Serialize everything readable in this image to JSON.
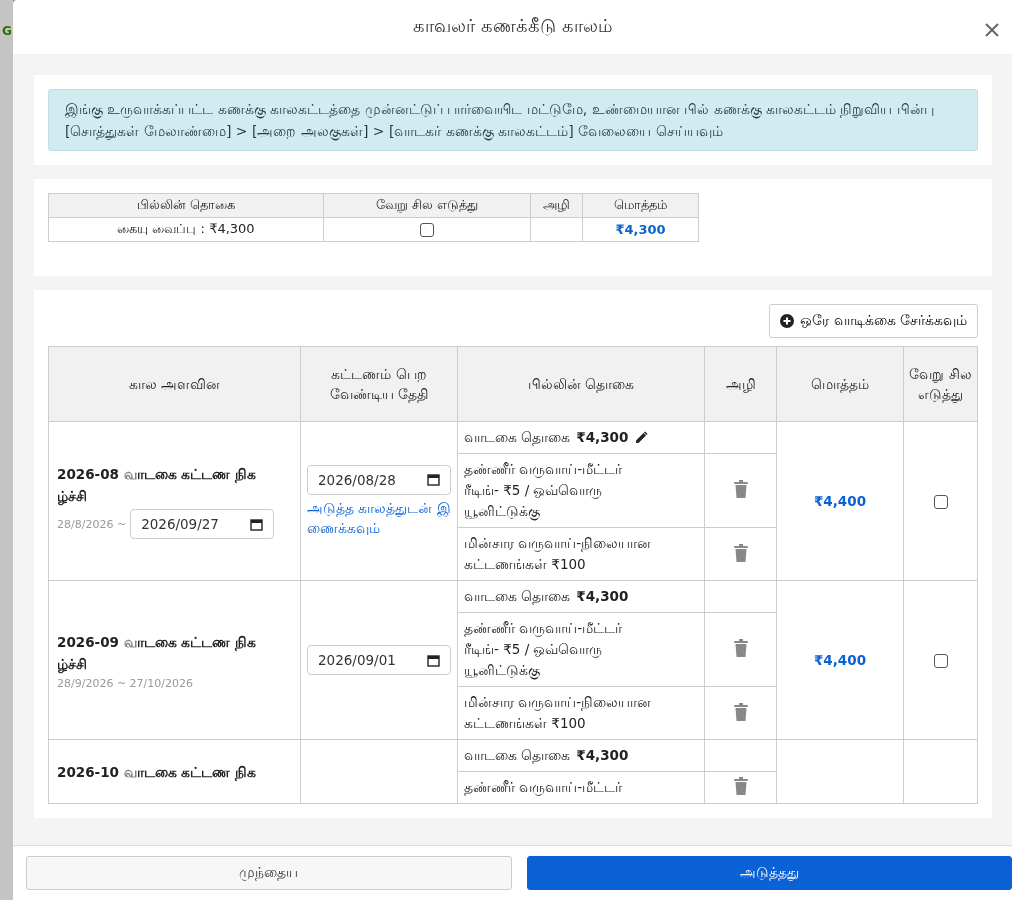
{
  "background_page": {
    "logo_text": "G"
  },
  "modal": {
    "title": "காவலர் கணக்கீடு காலம்",
    "notice": "இங்கு உருவாக்கப்பட்ட கணக்கு காலகட்டத்தை முன்னட்டுப் பார்வையிட மட்டுமே, உண்மையான பில் கணக்கு காலகட்டம் நிறுவிய பின்பு [சொத்துகள் மேலாண்மை] > [அறை அலகுகள்] > [வாடகர் கணக்கு காலகட்டம்] வேலையை செய்யவும்",
    "deposit_table": {
      "columns": [
        "பில்லின் தொகை",
        "வேறு சில எடுத்து",
        "அழி",
        "மொத்தம்"
      ],
      "row": {
        "amount": "கையு வைப்பு : ₹4,300",
        "checked": false,
        "total": "₹4,300"
      }
    },
    "add_button": "ஒரே வாடிக்கை சேர்க்கவும்",
    "periods_table": {
      "columns": [
        "கால அளவின",
        "கட்டணம் பெற வேண்டிய தேதி",
        "பில்லின் தொகை",
        "அழி",
        "மொத்தம்",
        "வேறு சில எடுத்து"
      ],
      "rows": [
        {
          "title": "2026-08 வாடகை கட்டண நிகழ்ச்சி",
          "range": "28/8/2026 ~",
          "end_date": "2026/09/27",
          "due_date": "2026/08/28",
          "link": "அடுத்த காலத்துடன் இணைக்கவும்",
          "total": "₹4,400",
          "checked": false,
          "items": [
            {
              "kind": "rent",
              "label": "வாடகை தொகை",
              "amount": "₹4,300",
              "editable": true
            },
            {
              "kind": "fee",
              "label": "தண்ணீர் வருவாய்-மீட்டர்\nரீடிங்- ₹5 / ஒவ்வொரு\nயூனிட்டுக்கு"
            },
            {
              "kind": "fee",
              "label": "மின்சார வருவாய்-நிலையான\nகட்டணங்கள் ₹100"
            }
          ]
        },
        {
          "title": "2026-09 வாடகை கட்டண நிகழ்ச்சி",
          "range": "28/9/2026 ~ 27/10/2026",
          "due_date": "2026/09/01",
          "total": "₹4,400",
          "checked": false,
          "items": [
            {
              "kind": "rent",
              "label": "வாடகை தொகை",
              "amount": "₹4,300",
              "editable": false
            },
            {
              "kind": "fee",
              "label": "தண்ணீர் வருவாய்-மீட்டர்\nரீடிங்- ₹5 / ஒவ்வொரு\nயூனிட்டுக்கு"
            },
            {
              "kind": "fee",
              "label": "மின்சார வருவாய்-நிலையான\nகட்டணங்கள் ₹100"
            }
          ]
        },
        {
          "title": "2026-10 வாடகை கட்டண நிக",
          "items": [
            {
              "kind": "rent",
              "label": "வாடகை தொகை",
              "amount": "₹4,300",
              "editable": false
            },
            {
              "kind": "fee",
              "label": "தண்ணீர் வருவாய்-மீட்டர்"
            }
          ]
        }
      ]
    },
    "footer": {
      "back_button": "முந்தைய",
      "next_button": "அடுத்தது"
    }
  }
}
